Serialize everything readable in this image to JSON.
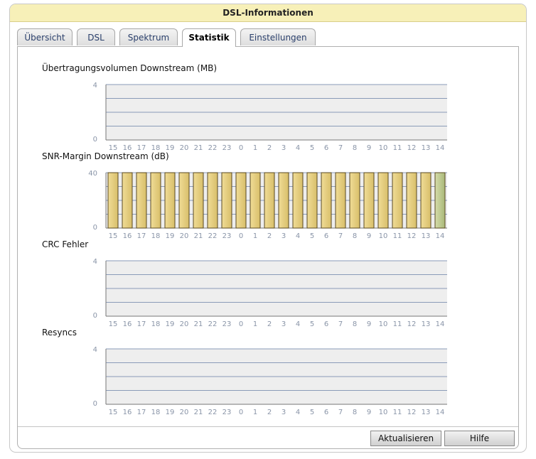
{
  "window": {
    "title": "DSL-Informationen"
  },
  "tabs": [
    {
      "label": "Übersicht",
      "active": false
    },
    {
      "label": "DSL",
      "active": false
    },
    {
      "label": "Spektrum",
      "active": false
    },
    {
      "label": "Statistik",
      "active": true
    },
    {
      "label": "Einstellungen",
      "active": false
    }
  ],
  "chart_data": [
    {
      "type": "bar",
      "title": "Übertragungsvolumen Downstream (MB)",
      "categories": [
        "15",
        "16",
        "17",
        "18",
        "19",
        "20",
        "21",
        "22",
        "23",
        "0",
        "1",
        "2",
        "3",
        "4",
        "5",
        "6",
        "7",
        "8",
        "9",
        "10",
        "11",
        "12",
        "13",
        "14"
      ],
      "values": [
        0,
        0,
        0,
        0,
        0,
        0,
        0,
        0,
        0,
        0,
        0,
        0,
        0,
        0,
        0,
        0,
        0,
        0,
        0,
        0,
        0,
        0,
        0,
        0
      ],
      "ylim": [
        0,
        4
      ],
      "yticks": [
        "0",
        "4"
      ],
      "grid": true
    },
    {
      "type": "bar",
      "title": "SNR-Margin Downstream (dB)",
      "categories": [
        "15",
        "16",
        "17",
        "18",
        "19",
        "20",
        "21",
        "22",
        "23",
        "0",
        "1",
        "2",
        "3",
        "4",
        "5",
        "6",
        "7",
        "8",
        "9",
        "10",
        "11",
        "12",
        "13",
        "14"
      ],
      "values": [
        40,
        40,
        40,
        40,
        40,
        40,
        40,
        40,
        40,
        40,
        40,
        40,
        40,
        40,
        40,
        40,
        40,
        40,
        40,
        40,
        40,
        40,
        40,
        40
      ],
      "ylim": [
        0,
        40
      ],
      "yticks": [
        "0",
        "40"
      ],
      "grid": true,
      "bar_color": "#d8bf6a",
      "highlight_last_color": "#a9b878"
    },
    {
      "type": "bar",
      "title": "CRC Fehler",
      "categories": [
        "15",
        "16",
        "17",
        "18",
        "19",
        "20",
        "21",
        "22",
        "23",
        "0",
        "1",
        "2",
        "3",
        "4",
        "5",
        "6",
        "7",
        "8",
        "9",
        "10",
        "11",
        "12",
        "13",
        "14"
      ],
      "values": [
        0,
        0,
        0,
        0,
        0,
        0,
        0,
        0,
        0,
        0,
        0,
        0,
        0,
        0,
        0,
        0,
        0,
        0,
        0,
        0,
        0,
        0,
        0,
        0
      ],
      "ylim": [
        0,
        4
      ],
      "yticks": [
        "0",
        "4"
      ],
      "grid": true
    },
    {
      "type": "bar",
      "title": "Resyncs",
      "categories": [
        "15",
        "16",
        "17",
        "18",
        "19",
        "20",
        "21",
        "22",
        "23",
        "0",
        "1",
        "2",
        "3",
        "4",
        "5",
        "6",
        "7",
        "8",
        "9",
        "10",
        "11",
        "12",
        "13",
        "14"
      ],
      "values": [
        0,
        0,
        0,
        0,
        0,
        0,
        0,
        0,
        0,
        0,
        0,
        0,
        0,
        0,
        0,
        0,
        0,
        0,
        0,
        0,
        0,
        0,
        0,
        0
      ],
      "ylim": [
        0,
        4
      ],
      "yticks": [
        "0",
        "4"
      ],
      "grid": true
    }
  ],
  "buttons": {
    "refresh_label": "Aktualisieren",
    "help_label": "Hilfe"
  },
  "colors": {
    "title_bar": "#f7f0b8",
    "plot_bg": "#eeeeee",
    "grid": "#8a9bb8",
    "tick_text": "#8a95a8"
  }
}
